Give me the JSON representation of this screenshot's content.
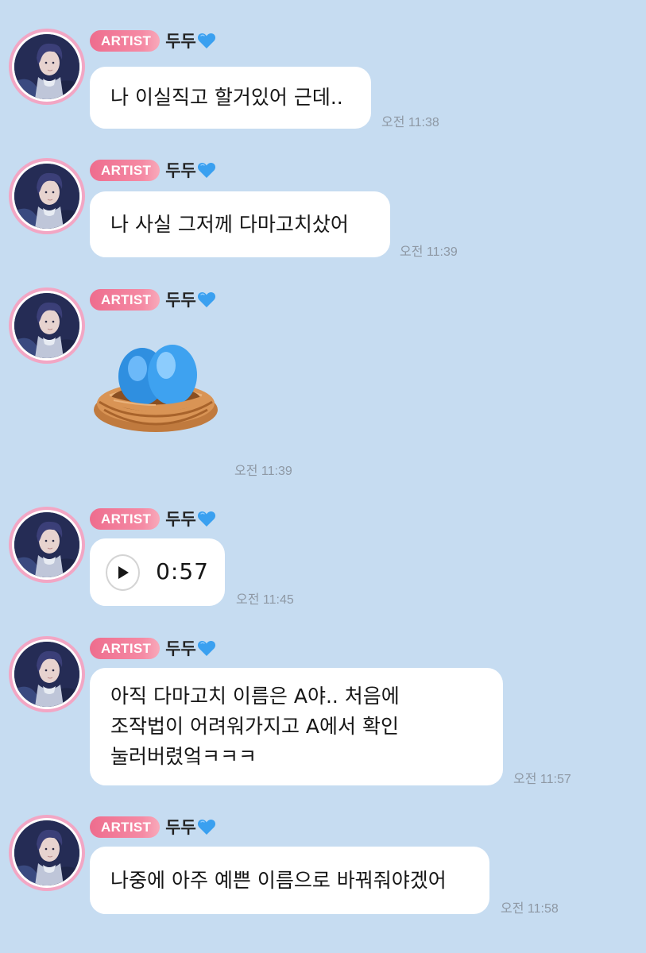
{
  "chat": {
    "messages": [
      {
        "badge": "ARTIST",
        "sender": "두두",
        "text": "나 이실직고 할거있어 근데..",
        "time": "오전 11:38"
      },
      {
        "badge": "ARTIST",
        "sender": "두두",
        "text": "나 사실 그저께 다마고치샀어",
        "time": "오전 11:39"
      },
      {
        "badge": "ARTIST",
        "sender": "두두",
        "emoji": "nest-with-eggs",
        "time": "오전 11:39"
      },
      {
        "badge": "ARTIST",
        "sender": "두두",
        "voice_duration": "0:57",
        "time": "오전 11:45"
      },
      {
        "badge": "ARTIST",
        "sender": "두두",
        "text": "아직 다마고치 이름은 A야.. 처음에\n조작법이 어려워가지고 A에서 확인\n눌러버렸엌ㅋㅋㅋ",
        "time": "오전 11:57"
      },
      {
        "badge": "ARTIST",
        "sender": "두두",
        "text": "나중에 아주 예쁜 이름으로 바꿔줘야겠어",
        "time": "오전 11:58"
      }
    ]
  },
  "colors": {
    "background": "#c6dcf1",
    "bubble": "#ffffff",
    "badge": "#ee6d8e",
    "avatar_ring": "#f2a6c4",
    "heart": "#3aa0f0",
    "time_text": "#8e98a4"
  },
  "icons": {
    "heart": "blue-heart-icon",
    "play": "play-icon",
    "emoji": "nest-with-eggs"
  }
}
